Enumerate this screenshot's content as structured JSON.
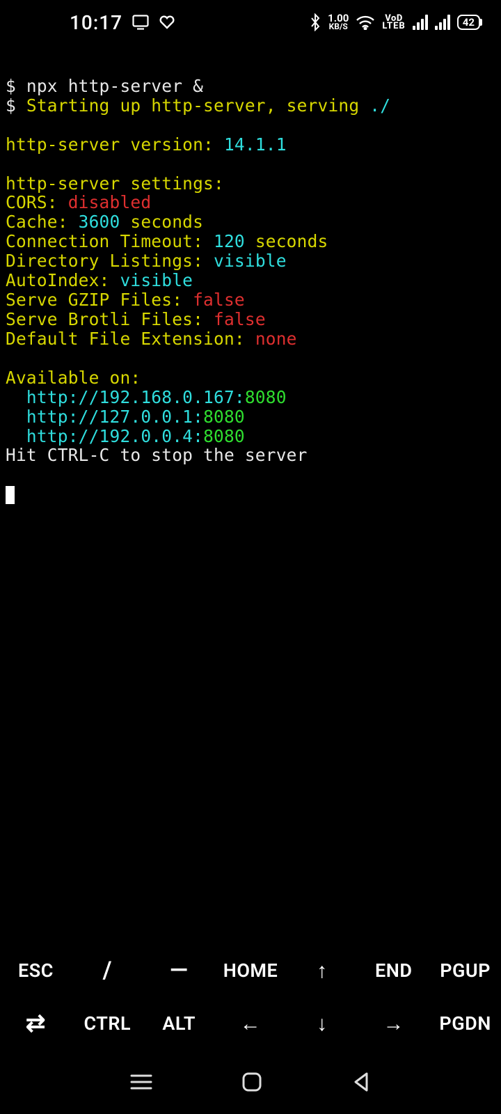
{
  "status": {
    "clock": "10:17",
    "speed_top": "1.00",
    "speed_bot": "KB/S",
    "volte_top": "VoD",
    "volte_bot": "LTEB",
    "battery": "42"
  },
  "term": {
    "prompt": "$ ",
    "cmd": "npx http-server &",
    "start_prefix": "Starting up http-server, serving ",
    "start_path": "./",
    "ver_label": "http-server version: ",
    "ver_value": "14.1.1",
    "settings_header": "http-server settings: ",
    "cors_label": "CORS: ",
    "cors_value": "disabled",
    "cache_label": "Cache: ",
    "cache_value": "3600 ",
    "cache_unit": "seconds",
    "conn_label": "Connection Timeout: ",
    "conn_value": "120 ",
    "conn_unit": "seconds",
    "dir_label": "Directory Listings: ",
    "dir_value": "visible",
    "auto_label": "AutoIndex: ",
    "auto_value": "visible",
    "gzip_label": "Serve GZIP Files: ",
    "gzip_value": "false",
    "brotli_label": "Serve Brotli Files: ",
    "brotli_value": "false",
    "ext_label": "Default File Extension: ",
    "ext_value": "none",
    "avail_header": "Available on:",
    "url1_pre": "  http://192.168.0.167:",
    "url1_port": "8080",
    "url2_pre": "  http://127.0.0.1:",
    "url2_port": "8080",
    "url3_pre": "  http://192.0.0.4:",
    "url3_port": "8080",
    "hit": "Hit CTRL-C to stop the server"
  },
  "keys": {
    "r1": {
      "esc": "ESC",
      "slash": "/",
      "dash": "―",
      "home": "HOME",
      "up": "↑",
      "end": "END",
      "pgup": "PGUP"
    },
    "r2": {
      "tab": "⇄",
      "ctrl": "CTRL",
      "alt": "ALT",
      "left": "←",
      "down": "↓",
      "right": "→",
      "pgdn": "PGDN"
    }
  }
}
